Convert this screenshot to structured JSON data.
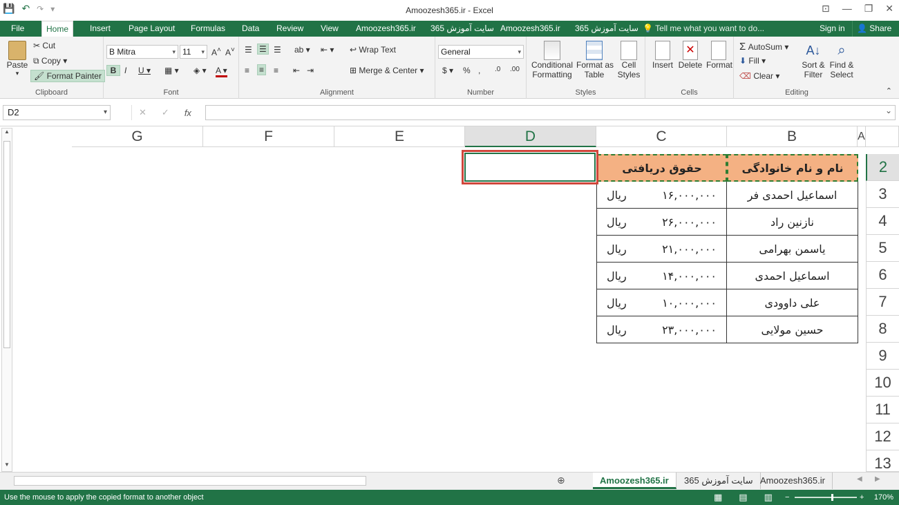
{
  "window": {
    "title": "Amoozesh365.ir - Excel",
    "controls": [
      "⊡",
      "—",
      "❐",
      "✕"
    ]
  },
  "qat": {
    "save": "💾",
    "undo": "↶",
    "redo": "↷",
    "more": "▾"
  },
  "tabs": {
    "items": [
      "File",
      "Home",
      "Insert",
      "Page Layout",
      "Formulas",
      "Data",
      "Review",
      "View",
      "Amoozesh365.ir",
      "سایت آموزش 365",
      "Amoozesh365.ir",
      "سایت آموزش 365"
    ],
    "active": "Home",
    "tell_me": "Tell me what you want to do...",
    "sign_in": "Sign in",
    "share": "Share"
  },
  "ribbon": {
    "clipboard": {
      "label": "Clipboard",
      "paste": "Paste",
      "cut": "Cut",
      "copy": "Copy",
      "format_painter": "Format Painter"
    },
    "font": {
      "label": "Font",
      "family": "B Mitra",
      "size": "11"
    },
    "alignment": {
      "label": "Alignment",
      "wrap_text": "Wrap Text",
      "merge_center": "Merge & Center"
    },
    "number": {
      "label": "Number",
      "format": "General",
      "currency": "$",
      "percent": "%",
      "comma": ","
    },
    "styles": {
      "label": "Styles",
      "conditional": "Conditional",
      "conditional2": "Formatting",
      "format_table": "Format as",
      "format_table2": "Table",
      "cell_styles": "Cell",
      "cell_styles2": "Styles"
    },
    "cells": {
      "label": "Cells",
      "insert": "Insert",
      "delete": "Delete",
      "format": "Format"
    },
    "editing": {
      "label": "Editing",
      "autosum": "AutoSum",
      "fill": "Fill",
      "clear": "Clear",
      "sort": "Sort &",
      "sort2": "Filter",
      "find": "Find &",
      "find2": "Select"
    }
  },
  "formula_bar": {
    "name_box": "D2",
    "cancel": "✕",
    "enter": "✓",
    "fx": "fx",
    "content": ""
  },
  "columns": [
    "G",
    "F",
    "E",
    "D",
    "C",
    "B",
    "A"
  ],
  "selected_column": "D",
  "rows": [
    "2",
    "3",
    "4",
    "5",
    "6",
    "7",
    "8",
    "9",
    "10",
    "11",
    "12",
    "13"
  ],
  "table": {
    "header_name": "نام و نام خانوادگی",
    "header_salary": "حقوق دریافتی",
    "currency": "ریال",
    "records": [
      {
        "name": "اسماعیل احمدی فر",
        "amount": "۱۶,۰۰۰,۰۰۰"
      },
      {
        "name": "نازنین راد",
        "amount": "۲۶,۰۰۰,۰۰۰"
      },
      {
        "name": "یاسمن بهرامی",
        "amount": "۲۱,۰۰۰,۰۰۰"
      },
      {
        "name": "اسماعیل احمدی",
        "amount": "۱۴,۰۰۰,۰۰۰"
      },
      {
        "name": "علی داوودی",
        "amount": "۱۰,۰۰۰,۰۰۰"
      },
      {
        "name": "حسین مولایی",
        "amount": "۲۳,۰۰۰,۰۰۰"
      }
    ]
  },
  "sheet_tabs": [
    "Amoozesh365.ir",
    "سایت آموزش 365",
    "Amoozesh365.ir"
  ],
  "active_sheet_index": 0,
  "status": {
    "message": "Use the mouse to apply the copied format to another object",
    "zoom": "170%"
  },
  "colors": {
    "excel_green": "#217346",
    "header_fill": "#f4b183",
    "selection_red": "#d0463b"
  }
}
